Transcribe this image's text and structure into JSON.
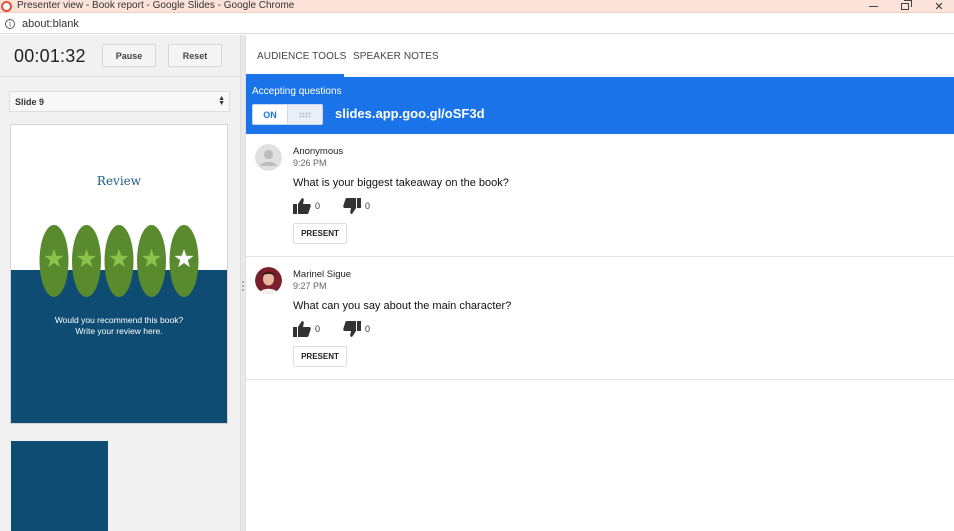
{
  "window": {
    "title": "Presenter view - Book report - Google Slides - Google Chrome",
    "url": "about:blank"
  },
  "presenter": {
    "timer": "00:01:32",
    "pause_label": "Pause",
    "reset_label": "Reset",
    "selected_slide": "Slide 9"
  },
  "slide": {
    "title": "Review",
    "text_line1": "Would you recommend this book?",
    "text_line2": "Write your review here.",
    "star_count": 5,
    "colors": {
      "top": "#ffffff",
      "bottom": "#0f4c73",
      "star_oval": "#5a8a2e",
      "star_fill": "#8bc34a"
    }
  },
  "tabs": [
    {
      "label": "AUDIENCE TOOLS",
      "active": true
    },
    {
      "label": "SPEAKER NOTES",
      "active": false
    }
  ],
  "banner": {
    "label": "Accepting questions",
    "toggle_on": "ON",
    "url": "slides.app.goo.gl/oSF3d",
    "color": "#1a73e8"
  },
  "questions": [
    {
      "author": "Anonymous",
      "time": "9:26 PM",
      "text": "What is your biggest takeaway on the book?",
      "upvotes": "0",
      "downvotes": "0",
      "present_label": "PRESENT",
      "avatar": "default-avatar-icon"
    },
    {
      "author": "Marinel Sigue",
      "time": "9:27 PM",
      "text": "What can you say about the main character?",
      "upvotes": "0",
      "downvotes": "0",
      "present_label": "PRESENT",
      "avatar": "user-photo"
    }
  ]
}
